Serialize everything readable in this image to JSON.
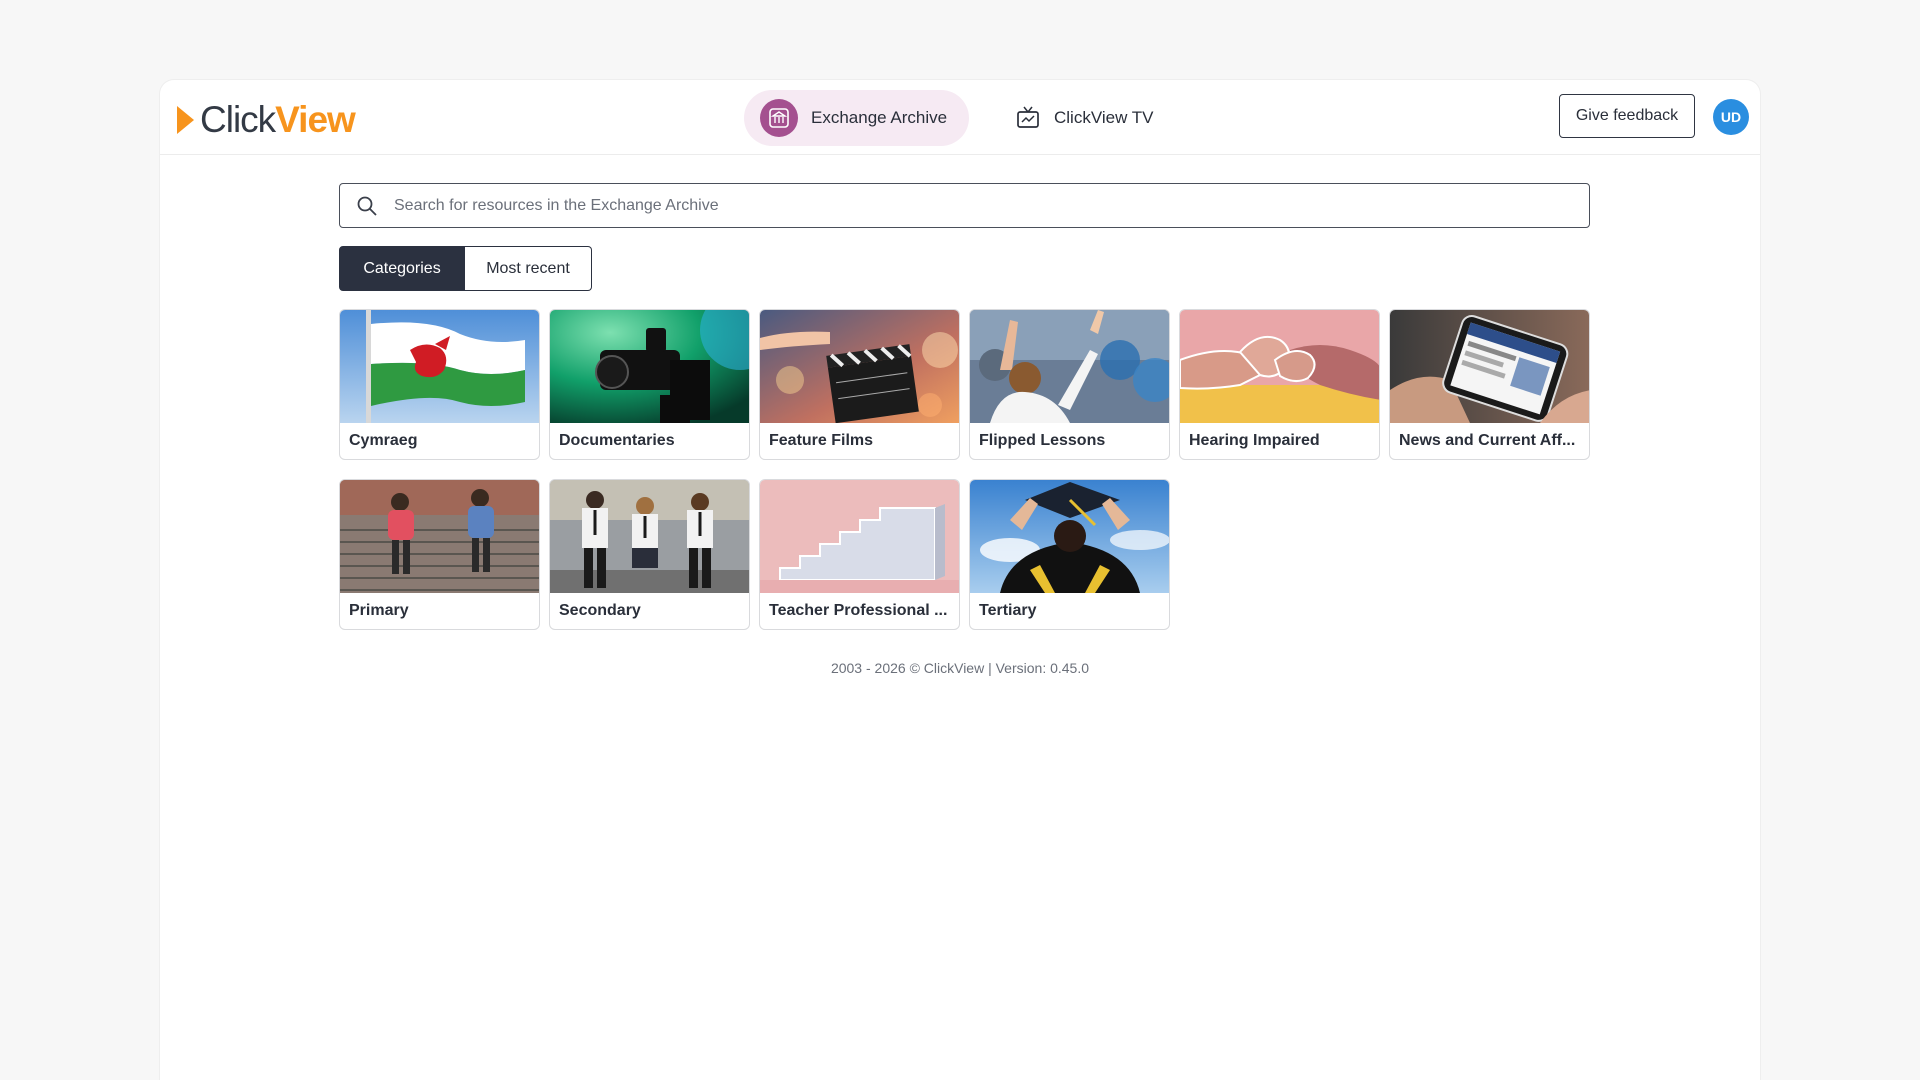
{
  "header": {
    "logo": {
      "part1": "Click",
      "part2": "View"
    },
    "nav": [
      {
        "label": "Exchange Archive",
        "icon": "archive-building-icon",
        "active": true
      },
      {
        "label": "ClickView TV",
        "icon": "tv-icon",
        "active": false
      }
    ],
    "feedback_label": "Give feedback",
    "avatar_initials": "UD"
  },
  "search": {
    "placeholder": "Search for resources in the Exchange Archive",
    "value": ""
  },
  "tabs": [
    {
      "label": "Categories",
      "active": true
    },
    {
      "label": "Most recent",
      "active": false
    }
  ],
  "categories": [
    {
      "label": "Cymraeg",
      "icon": "welsh-flag-image"
    },
    {
      "label": "Documentaries",
      "icon": "camera-image"
    },
    {
      "label": "Feature Films",
      "icon": "clapperboard-image"
    },
    {
      "label": "Flipped Lessons",
      "icon": "classroom-image"
    },
    {
      "label": "Hearing Impaired",
      "icon": "sign-language-image"
    },
    {
      "label": "News and Current Aff...",
      "icon": "phone-news-image"
    },
    {
      "label": "Primary",
      "icon": "primary-students-image"
    },
    {
      "label": "Secondary",
      "icon": "secondary-students-image"
    },
    {
      "label": "Teacher Professional ...",
      "icon": "stairs-image"
    },
    {
      "label": "Tertiary",
      "icon": "graduation-cap-image"
    }
  ],
  "footer": {
    "text": "2003 - 2026 © ClickView | Version: 0.45.0"
  },
  "colors": {
    "accent": "#f7941d",
    "nav_active_bg": "#f6eaf3",
    "nav_icon": "#a4508f",
    "tab_active": "#2b3140",
    "avatar": "#2a8ee0"
  }
}
